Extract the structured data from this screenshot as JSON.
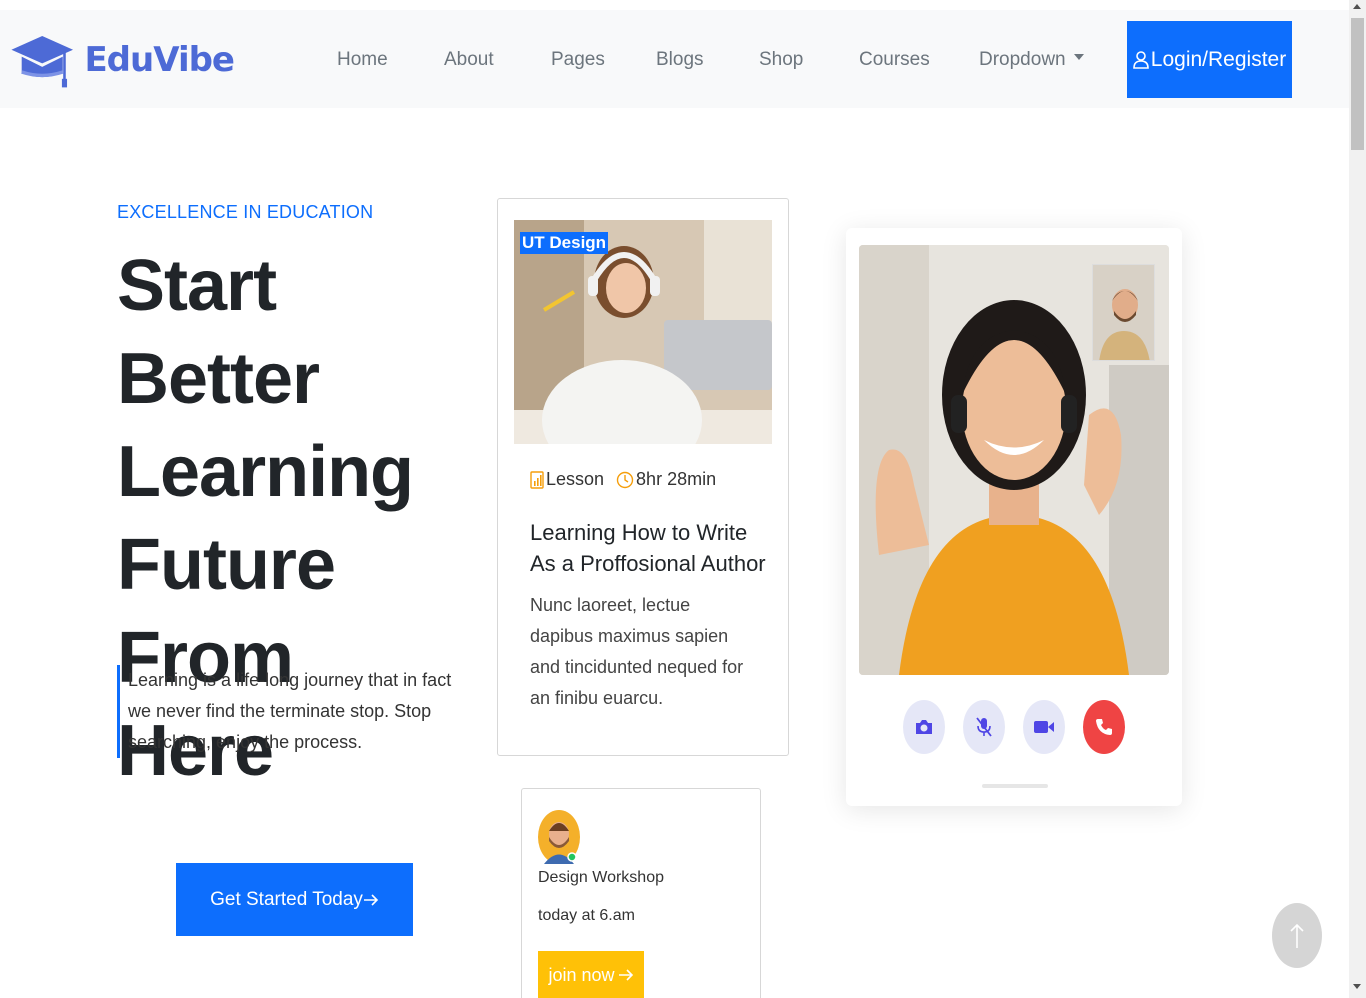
{
  "nav": {
    "brand": "EduVibe",
    "items": [
      "Home",
      "About",
      "Pages",
      "Blogs",
      "Shop",
      "Courses",
      "Dropdown"
    ],
    "login_label": "Login/Register"
  },
  "hero": {
    "eyebrow": "EXCELLENCE IN EDUCATION",
    "title_lines": [
      "Start Better",
      "Learning",
      "Future From",
      "Here"
    ],
    "quote": "Learning is a life-long journey that in fact we never find the terminate stop. Stop searching, enjoy the process.",
    "cta_label": "Get Started Today"
  },
  "course_card": {
    "tag": "UT Design",
    "lesson_label": "Lesson",
    "duration": "8hr 28min",
    "title": "Learning How to Write As a Proffosional Author",
    "description": "Nunc laoreet, lectue dapibus maximus sapien and tincidunted nequed for an finibu euarcu."
  },
  "workshop": {
    "title": "Design Workshop",
    "time": "today at 6.am",
    "join_label": "join now"
  },
  "colors": {
    "primary": "#0d6efd",
    "brand": "#4d6ad6",
    "warning": "#ffc107",
    "danger": "#ef4444",
    "nav_bg": "#f8f9fa"
  },
  "icons": {
    "logo": "graduation-cap-icon",
    "login": "user-icon",
    "lesson": "bar-chart-icon",
    "duration": "clock-icon",
    "controls": [
      "camera-icon",
      "mic-off-icon",
      "video-icon",
      "phone-icon"
    ],
    "to_top": "arrow-up-icon"
  }
}
